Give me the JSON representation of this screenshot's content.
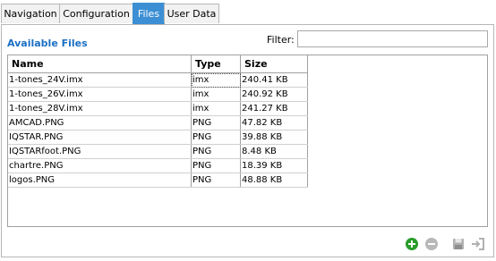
{
  "tabs": [
    {
      "label": "Navigation",
      "active": false
    },
    {
      "label": "Configuration",
      "active": false
    },
    {
      "label": "Files",
      "active": true
    },
    {
      "label": "User Data",
      "active": false
    }
  ],
  "section_title": "Available Files",
  "filter": {
    "label": "Filter:",
    "value": ""
  },
  "table": {
    "headers": [
      "Name",
      "Type",
      "Size"
    ],
    "rows": [
      [
        "1-tones_24V.imx",
        "imx",
        "240.41 KB"
      ],
      [
        "1-tones_26V.imx",
        "imx",
        "240.92 KB"
      ],
      [
        "1-tones_28V.imx",
        "imx",
        "241.27 KB"
      ],
      [
        "AMCAD.PNG",
        "PNG",
        "47.82 KB"
      ],
      [
        "IQSTAR.PNG",
        "PNG",
        "39.88 KB"
      ],
      [
        "IQSTARfoot.PNG",
        "PNG",
        "8.48 KB"
      ],
      [
        "chartre.PNG",
        "PNG",
        "18.39 KB"
      ],
      [
        "logos.PNG",
        "PNG",
        "48.88 KB"
      ]
    ]
  },
  "toolbar": {
    "add_icon": "plus-circle-icon",
    "remove_icon": "minus-circle-icon",
    "save_icon": "floppy-disk-icon",
    "export_icon": "arrow-into-box-icon"
  },
  "colors": {
    "accent": "#3c8fd4",
    "title": "#1b6fc4",
    "add": "#2a9d2a"
  }
}
